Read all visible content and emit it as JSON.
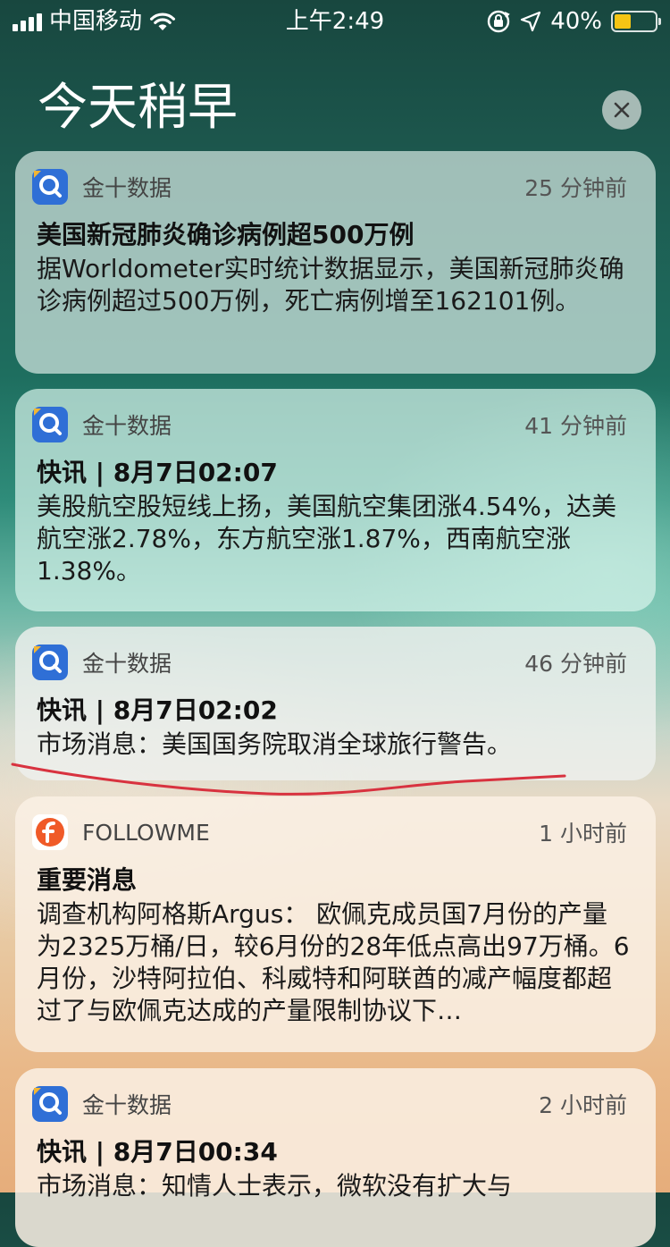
{
  "status_bar": {
    "carrier": "中国移动",
    "time": "上午2:49",
    "battery_percent": "40%",
    "battery_level": 0.4,
    "icons": [
      "signal-icon",
      "wifi-icon",
      "orientation-lock-icon",
      "location-icon",
      "battery-icon"
    ]
  },
  "header": {
    "title": "今天稍早",
    "clear_icon": "close-icon"
  },
  "notifications": [
    {
      "app": "金十数据",
      "time": "25 分钟前",
      "title": "美国新冠肺炎确诊病例超500万例",
      "body": "据Worldometer实时统计数据显示，美国新冠肺炎确诊病例超过500万例，死亡病例增至162101例。"
    },
    {
      "app": "金十数据",
      "time": "41 分钟前",
      "title": "快讯 | 8月7日02:07",
      "body": "美股航空股短线上扬，美国航空集团涨4.54%，达美航空涨2.78%，东方航空涨1.87%，西南航空涨1.38%。"
    },
    {
      "app": "金十数据",
      "time": "46 分钟前",
      "title": "快讯 | 8月7日02:02",
      "body": "市场消息：美国国务院取消全球旅行警告。"
    },
    {
      "app": "FOLLOWME",
      "time": "1 小时前",
      "title": "重要消息",
      "body": "调查机构阿格斯Argus： 欧佩克成员国7月份的产量为2325万桶/日，较6月份的28年低点高出97万桶。6月份，沙特阿拉伯、科威特和阿联酋的减产幅度都超过了与欧佩克达成的产量限制协议下…"
    },
    {
      "app": "金十数据",
      "time": "2 小时前",
      "title": "快讯 | 8月7日00:34",
      "body": "市场消息：知情人士表示，微软没有扩大与"
    }
  ],
  "colors": {
    "annotation_ink": "#d8323f",
    "jinshi_icon": "#2f6fd6",
    "followme_icon": "#f05a28"
  }
}
